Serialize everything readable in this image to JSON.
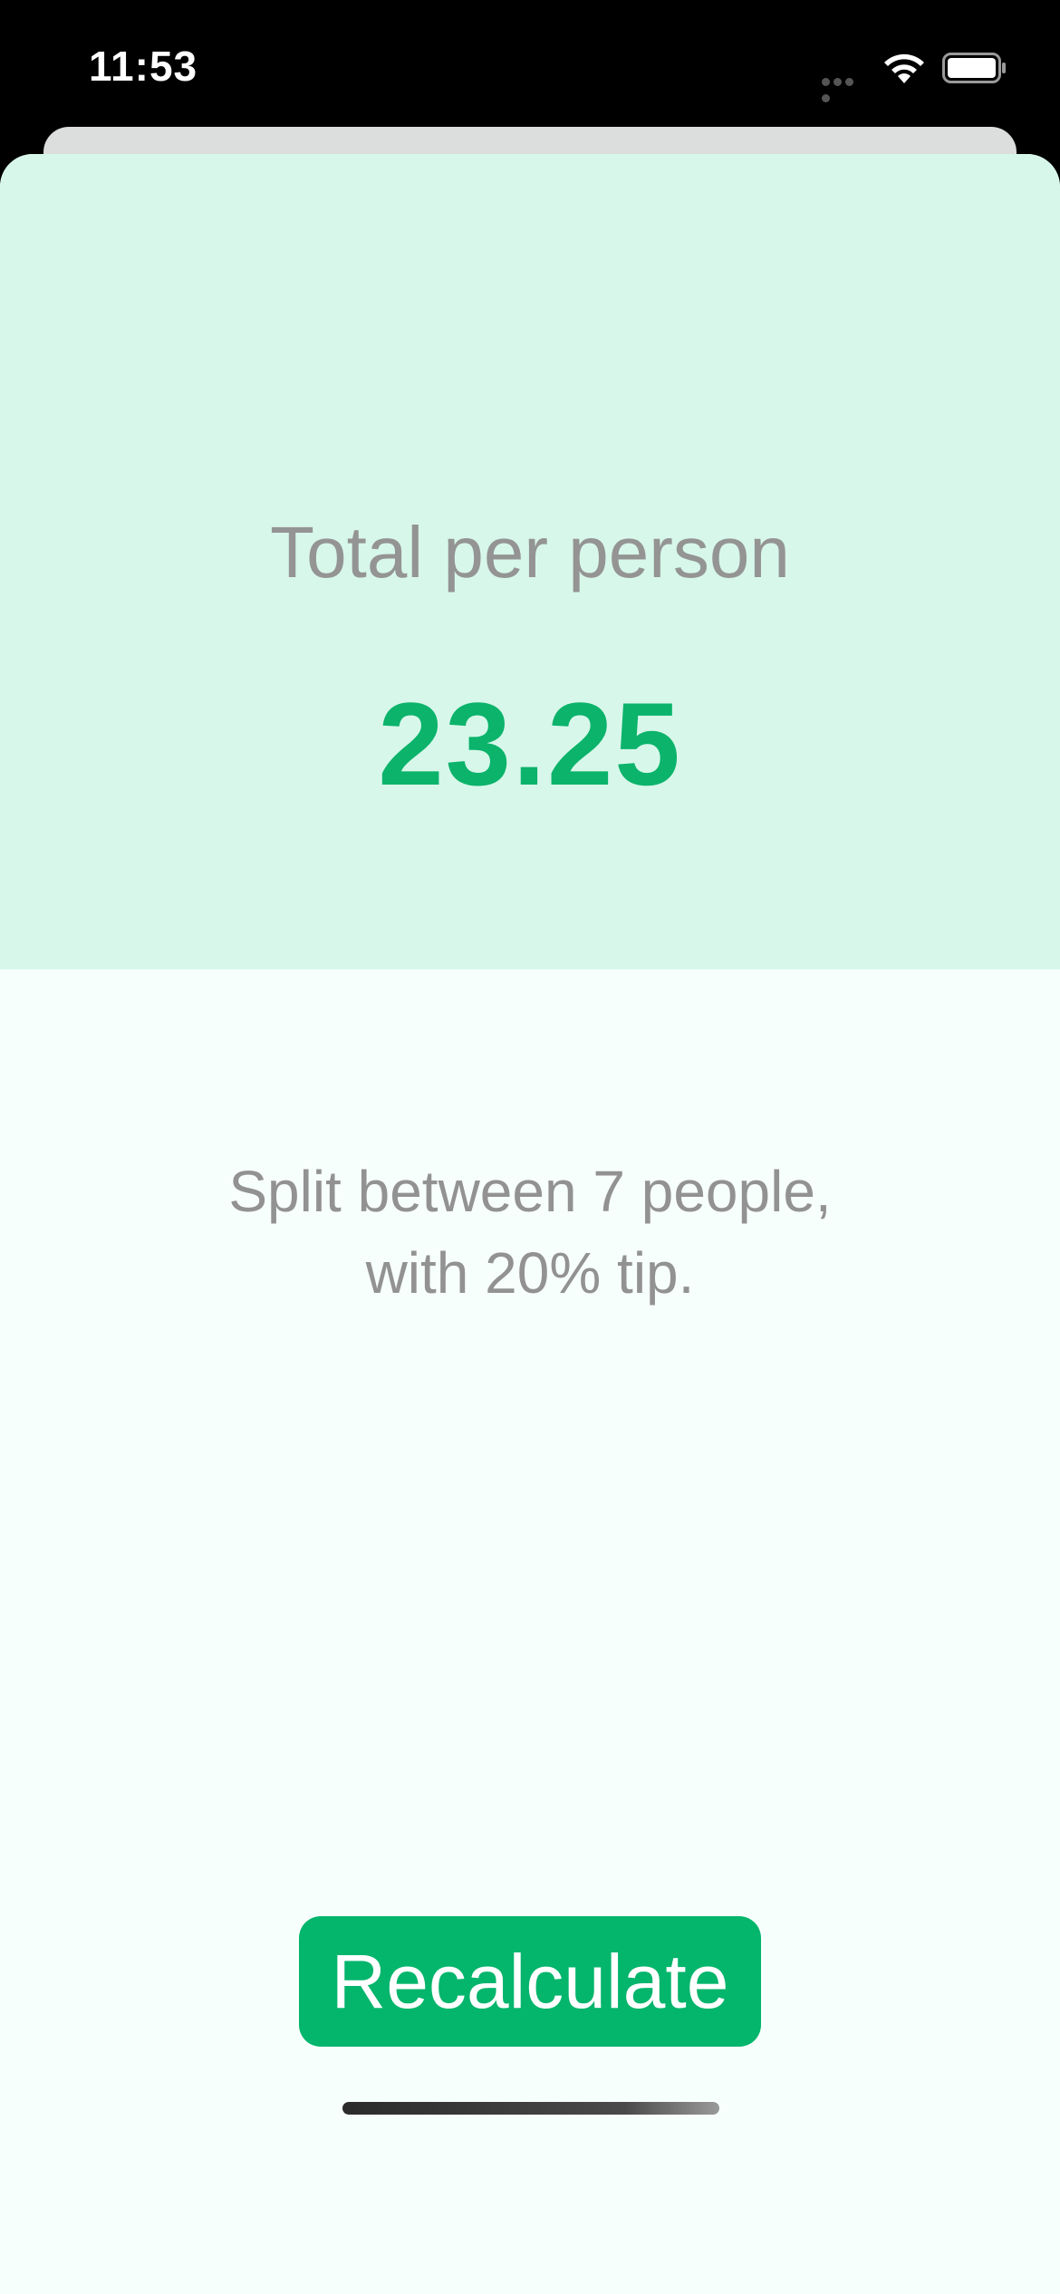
{
  "status_bar": {
    "time": "11:53",
    "icons": [
      "signal-dots-icon",
      "wifi-icon",
      "battery-icon"
    ]
  },
  "result": {
    "label": "Total per person",
    "value": "23.25"
  },
  "summary": {
    "line1": "Split between 7 people,",
    "line2": "with 20% tip."
  },
  "actions": {
    "recalculate_label": "Recalculate"
  },
  "colors": {
    "accent": "#04b56c",
    "panel": "#d7f7ea",
    "background": "#f7fffc",
    "muted_text": "#929292"
  }
}
